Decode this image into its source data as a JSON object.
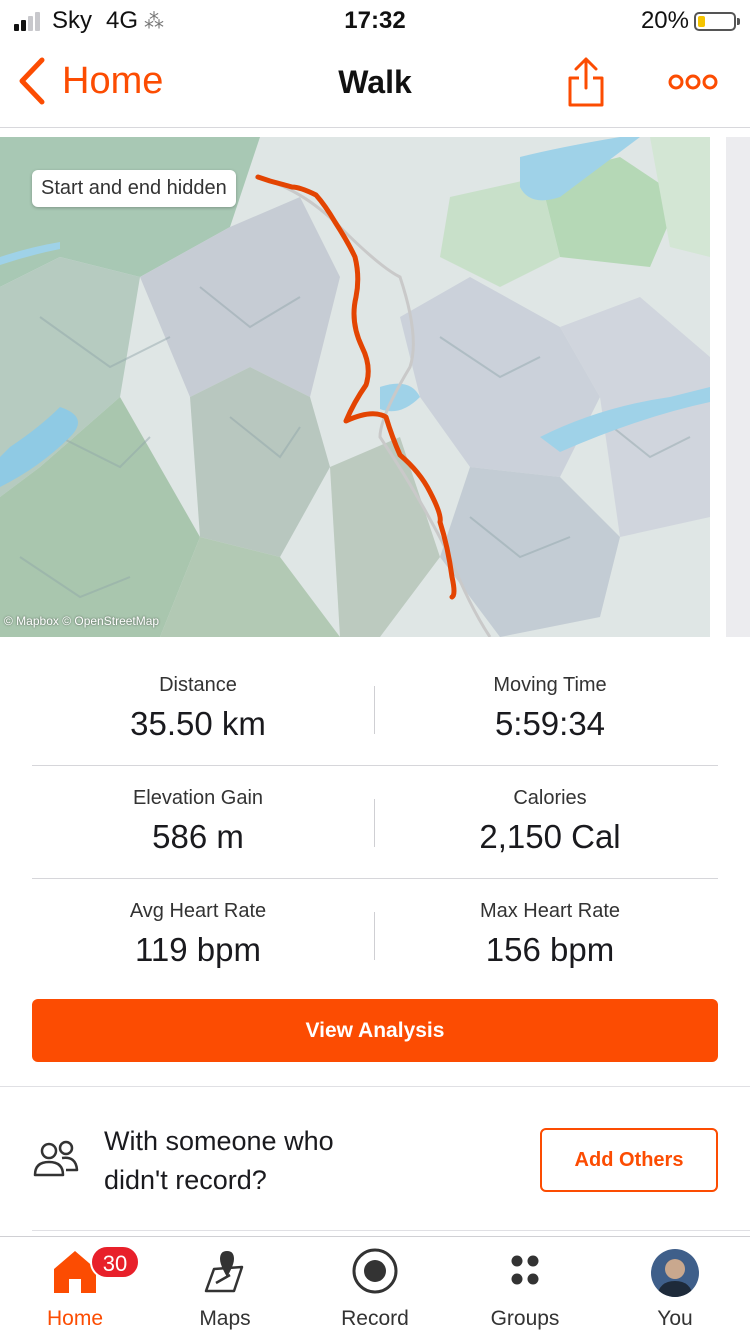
{
  "status_bar": {
    "carrier": "Sky",
    "network": "4G",
    "time": "17:32",
    "battery": "20%",
    "battery_level": 0.2,
    "signal_bars": 2
  },
  "nav": {
    "back_label": "Home",
    "title": "Walk",
    "share_icon": "share-icon",
    "more_icon": "more-icon"
  },
  "map": {
    "privacy_label": "Start and end hidden",
    "attribution": "© Mapbox © OpenStreetMap",
    "route_color": "#e34402"
  },
  "stats": [
    {
      "label": "Distance",
      "value": "35.50 km"
    },
    {
      "label": "Moving Time",
      "value": "5:59:34"
    },
    {
      "label": "Elevation Gain",
      "value": "586 m"
    },
    {
      "label": "Calories",
      "value": "2,150 Cal"
    },
    {
      "label": "Avg Heart Rate",
      "value": "119 bpm"
    },
    {
      "label": "Max Heart Rate",
      "value": "156 bpm"
    }
  ],
  "view_analysis_label": "View Analysis",
  "add_others": {
    "prompt": "With someone who didn't record?",
    "button_label": "Add Others",
    "icon": "people-icon"
  },
  "tabs": [
    {
      "label": "Home",
      "icon": "home-icon",
      "badge": "30",
      "active": true
    },
    {
      "label": "Maps",
      "icon": "map-icon"
    },
    {
      "label": "Record",
      "icon": "record-icon"
    },
    {
      "label": "Groups",
      "icon": "groups-icon"
    },
    {
      "label": "You",
      "icon": "avatar"
    }
  ],
  "colors": {
    "accent": "#fc4c02",
    "badge": "#e8202a"
  }
}
